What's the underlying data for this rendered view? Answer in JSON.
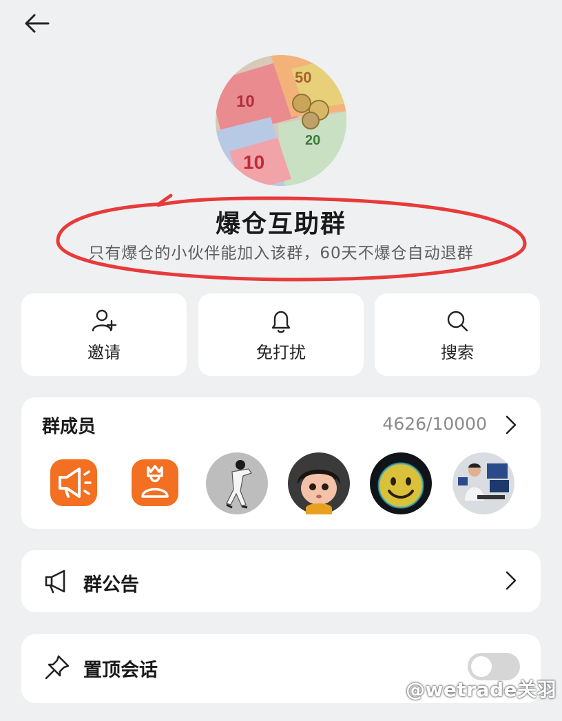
{
  "group": {
    "name": "爆仓互助群",
    "description": "只有爆仓的小伙伴能加入该群，60天不爆仓自动退群"
  },
  "actions": {
    "invite_label": "邀请",
    "dnd_label": "免打扰",
    "search_label": "搜索"
  },
  "members": {
    "title": "群成员",
    "count": "4626/10000"
  },
  "settings": {
    "notice_label": "群公告",
    "pin_label": "置顶会话",
    "pin_enabled": false
  },
  "watermark": "@wetrade关羽",
  "colors": {
    "accent_orange": "#f36f21",
    "highlight_red": "#e83a3a",
    "toggle_off": "#d6d6d6"
  }
}
